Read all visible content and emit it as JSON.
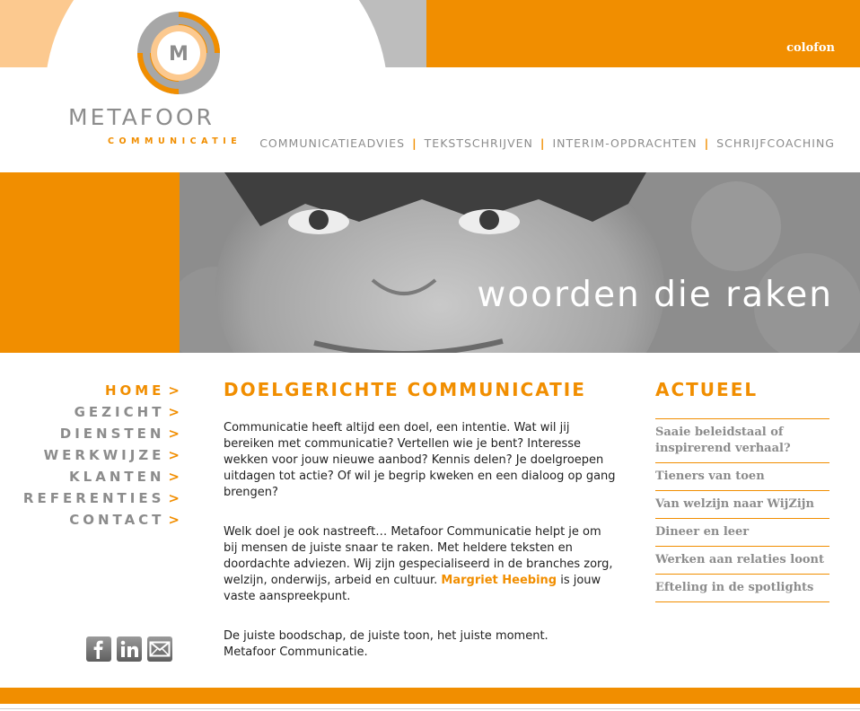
{
  "header": {
    "colofon_label": "colofon",
    "logo_letter": "M",
    "logo_name": "METAFOOR",
    "logo_subtitle": "COMMUNICATIE"
  },
  "top_nav": {
    "items": [
      {
        "label": "COMMUNICATIEADVIES"
      },
      {
        "label": "TEKSTSCHRIJVEN"
      },
      {
        "label": "INTERIM-OPDRACHTEN"
      },
      {
        "label": "SCHRIJFCOACHING"
      }
    ],
    "separator": "|"
  },
  "hero": {
    "tagline": "woorden die raken"
  },
  "left_nav": {
    "arrow": ">",
    "items": [
      {
        "label": "HOME",
        "active": true
      },
      {
        "label": "GEZICHT"
      },
      {
        "label": "DIENSTEN"
      },
      {
        "label": "WERKWIJZE"
      },
      {
        "label": "KLANTEN"
      },
      {
        "label": "REFERENTIES"
      },
      {
        "label": "CONTACT"
      }
    ]
  },
  "social": [
    {
      "icon": "facebook-icon"
    },
    {
      "icon": "linkedin-icon"
    },
    {
      "icon": "mail-icon"
    }
  ],
  "main": {
    "title": "DOELGERICHTE COMMUNICATIE",
    "paragraph1": "Communicatie heeft altijd een doel, een intentie. Wat wil jij bereiken met communicatie? Vertellen wie je bent? Interesse wekken voor jouw nieuwe aanbod? Kennis delen? Je doelgroepen uitdagen tot actie? Of wil je begrip kweken en een dialoog op gang brengen?",
    "paragraph2_before": "Welk doel je ook nastreeft… Metafoor Communicatie helpt je om bij mensen de juiste snaar te raken. Met heldere teksten en doordachte adviezen. Wij zijn gespecialiseerd in de branches zorg, welzijn, onderwijs, arbeid en cultuur. ",
    "paragraph2_link": "Margriet Heebing",
    "paragraph2_after": " is jouw vaste aanspreekpunt.",
    "paragraph3_line1": "De juiste boodschap, de juiste toon, het juiste moment.",
    "paragraph3_line2": "Metafoor Communicatie."
  },
  "actueel": {
    "title": "ACTUEEL",
    "items": [
      {
        "label": "Saaie beleidstaal of inspirerend verhaal?"
      },
      {
        "label": "Tieners van toen"
      },
      {
        "label": "Van welzijn naar WijZijn"
      },
      {
        "label": "Dineer en leer"
      },
      {
        "label": "Werken aan relaties loont"
      },
      {
        "label": "Efteling in de spotlights"
      }
    ]
  },
  "colors": {
    "orange": "#f18e00",
    "peach": "#fcc98f",
    "grey_text": "#8c8c8c",
    "grey_band": "#bdbdbd"
  }
}
